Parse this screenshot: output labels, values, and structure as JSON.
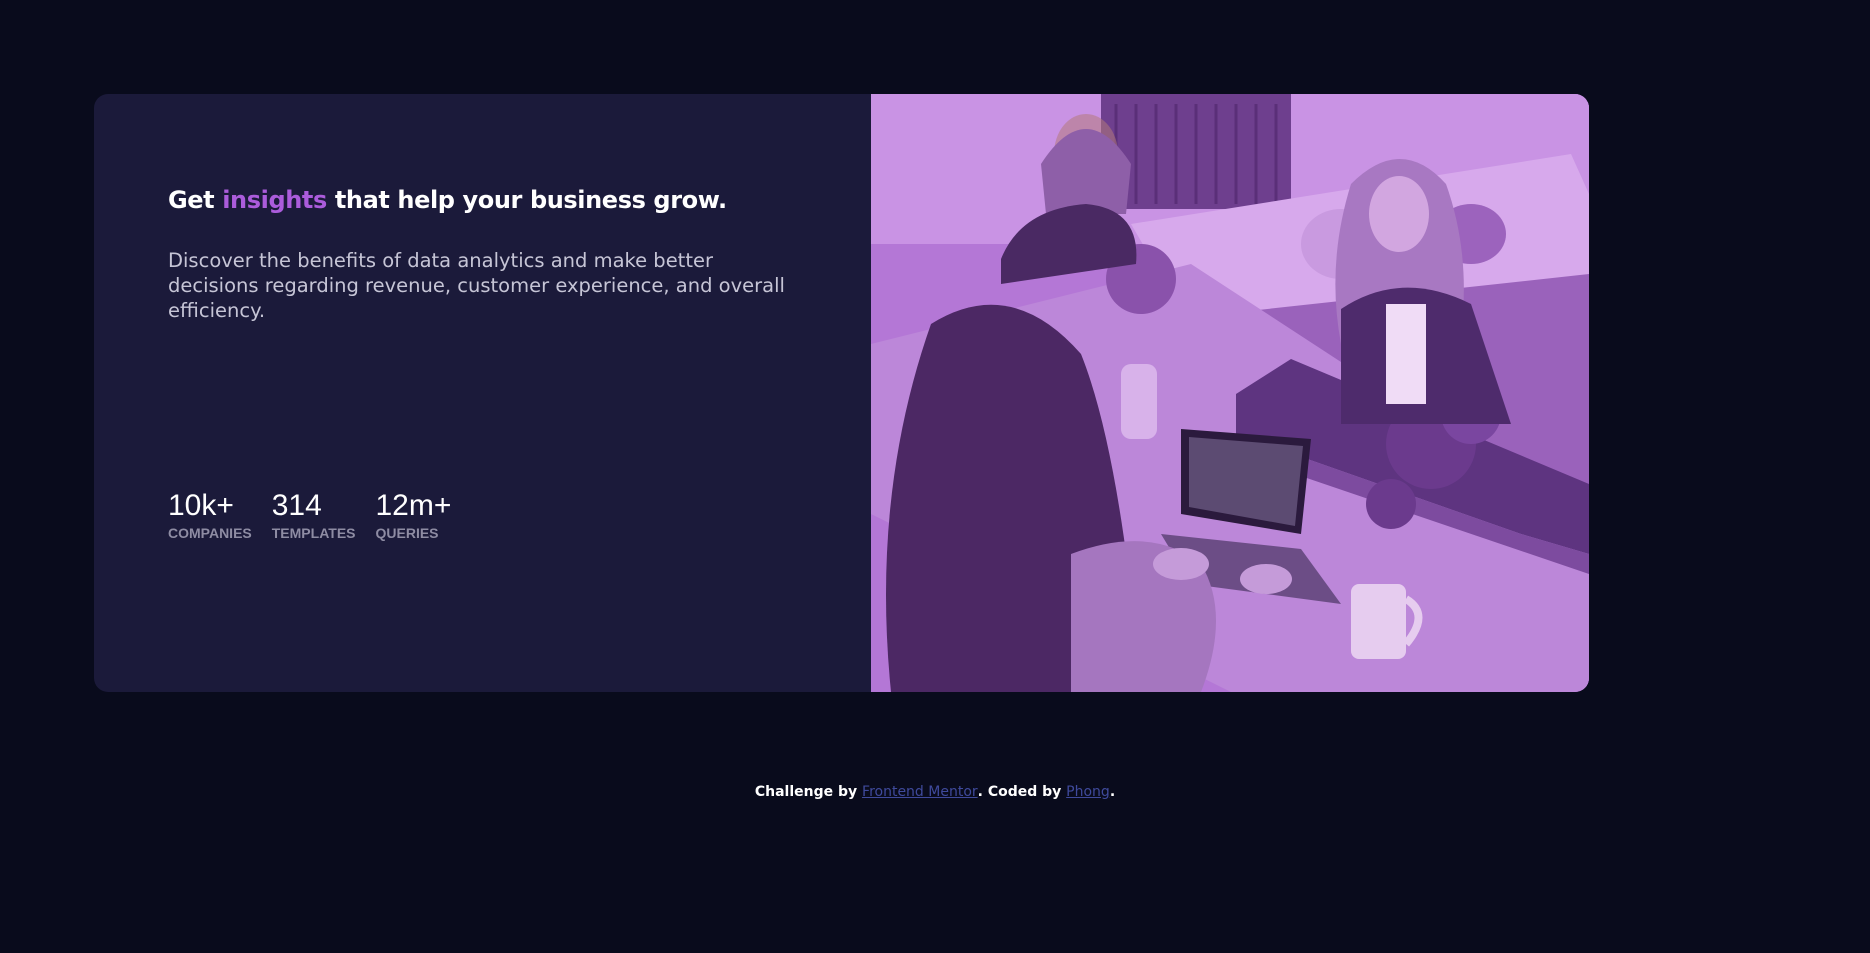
{
  "card": {
    "heading": {
      "before": "Get ",
      "accent": "insights",
      "after": " that help your business grow."
    },
    "description": "Discover the benefits of data analytics and make better decisions regarding revenue, customer experience, and overall efficiency.",
    "stats": [
      {
        "value": "10k+",
        "label": "COMPANIES"
      },
      {
        "value": "314",
        "label": "TEMPLATES"
      },
      {
        "value": "12m+",
        "label": "QUERIES"
      }
    ]
  },
  "footer": {
    "prefix": "Challenge by ",
    "link1": "Frontend Mentor",
    "middle": ". Coded by ",
    "link2": "Phong",
    "suffix": "."
  },
  "colors": {
    "page_background": "#090b1c",
    "card_background": "#1b1a3a",
    "accent": "#ab5cdb",
    "image_overlay": "#a55fc6",
    "link": "#3f4a9c"
  }
}
